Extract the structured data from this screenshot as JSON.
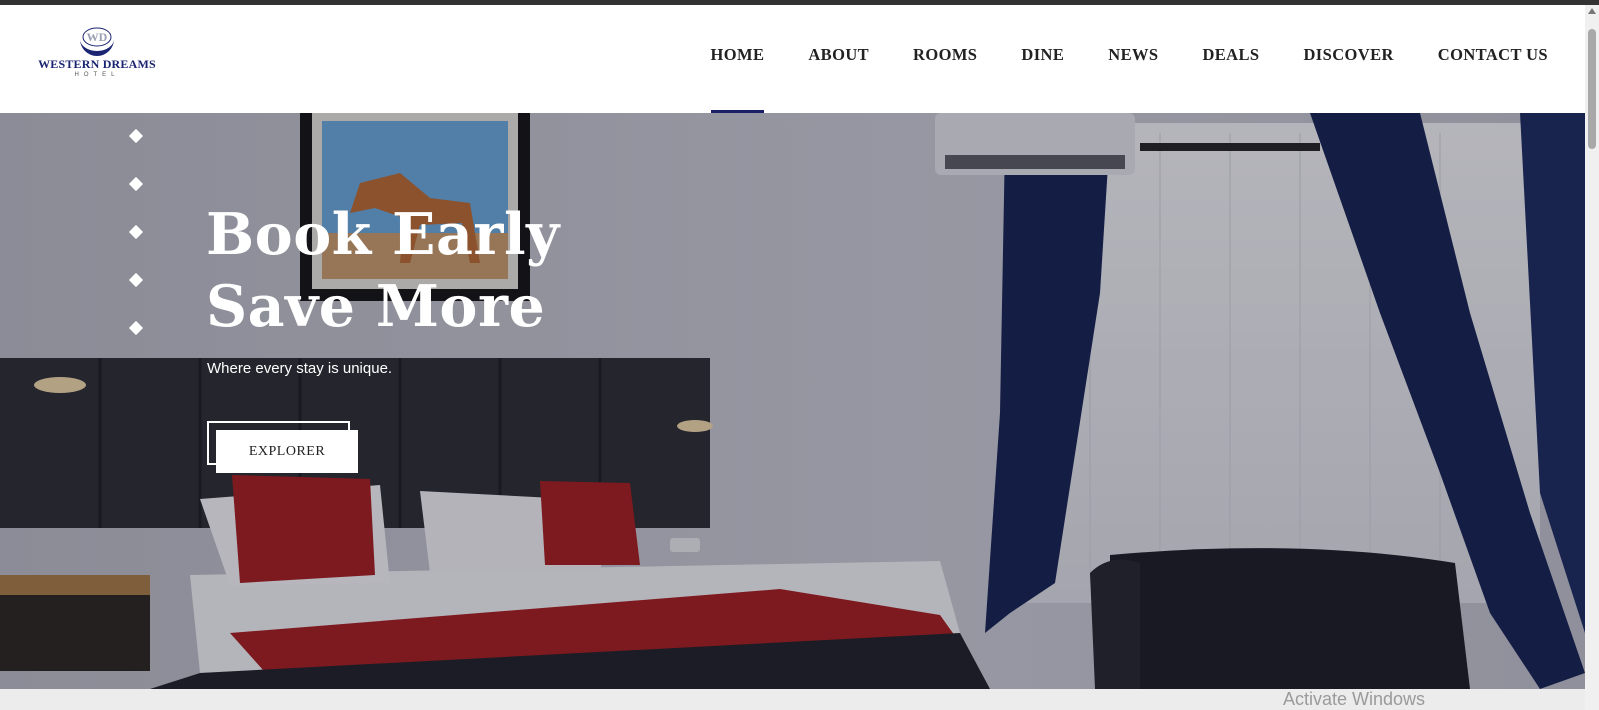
{
  "logo": {
    "monogram": "WD",
    "name": "WESTERN DREAMS",
    "subtitle": "HOTEL"
  },
  "nav": {
    "items": [
      {
        "label": "HOME",
        "active": true
      },
      {
        "label": "ABOUT",
        "active": false
      },
      {
        "label": "ROOMS",
        "active": false
      },
      {
        "label": "DINE",
        "active": false
      },
      {
        "label": "NEWS",
        "active": false
      },
      {
        "label": "DEALS",
        "active": false
      },
      {
        "label": "DISCOVER",
        "active": false
      },
      {
        "label": "CONTACT US",
        "active": false
      }
    ]
  },
  "hero": {
    "title_line1": "Book Early",
    "title_line2": "Save More",
    "subtitle": "Where every stay is unique.",
    "button_label": "EXPLORER",
    "slide_count": 5
  },
  "os": {
    "watermark": "Activate Windows"
  },
  "colors": {
    "accent": "#1b1f66",
    "bedspread_red": "#a51c1c",
    "curtain_blue": "#14214f"
  }
}
